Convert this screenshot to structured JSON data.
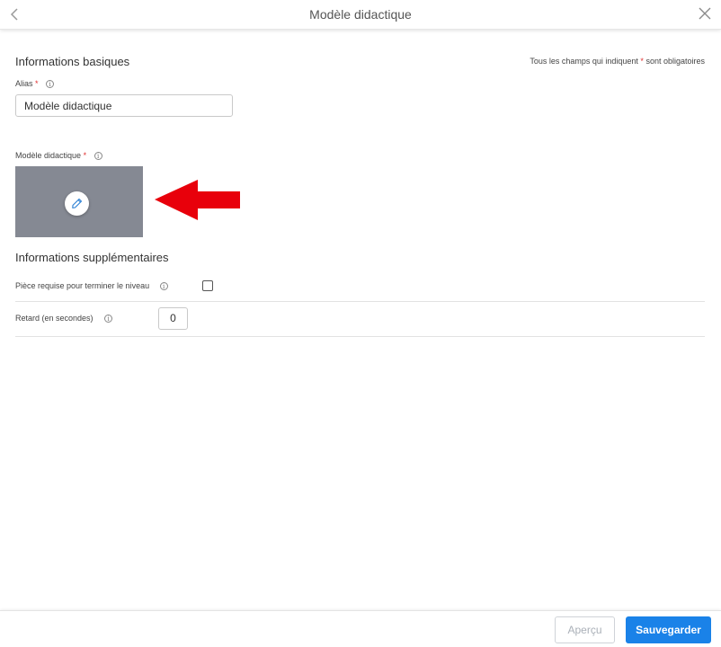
{
  "header": {
    "title": "Modèle didactique",
    "back_icon": "chevron-left-icon",
    "close_icon": "close-icon"
  },
  "basic": {
    "section_title": "Informations basiques",
    "required_note_prefix": "Tous les champs qui indiquent",
    "required_star": "*",
    "required_note_suffix": "sont obligatoires",
    "alias": {
      "label": "Alias",
      "value": "Modèle didactique"
    },
    "template": {
      "label": "Modèle didactique",
      "edit_icon": "pencil-icon"
    }
  },
  "extra": {
    "section_title": "Informations supplémentaires",
    "piece_required": {
      "label": "Pièce requise pour terminer le niveau",
      "checked": false
    },
    "delay": {
      "label": "Retard (en secondes)",
      "value": "0"
    }
  },
  "footer": {
    "preview_label": "Aperçu",
    "save_label": "Sauvegarder"
  },
  "colors": {
    "accent": "#1a82e8",
    "required": "#e03030",
    "image_placeholder": "#858993",
    "annotation_arrow": "#e8000b"
  }
}
